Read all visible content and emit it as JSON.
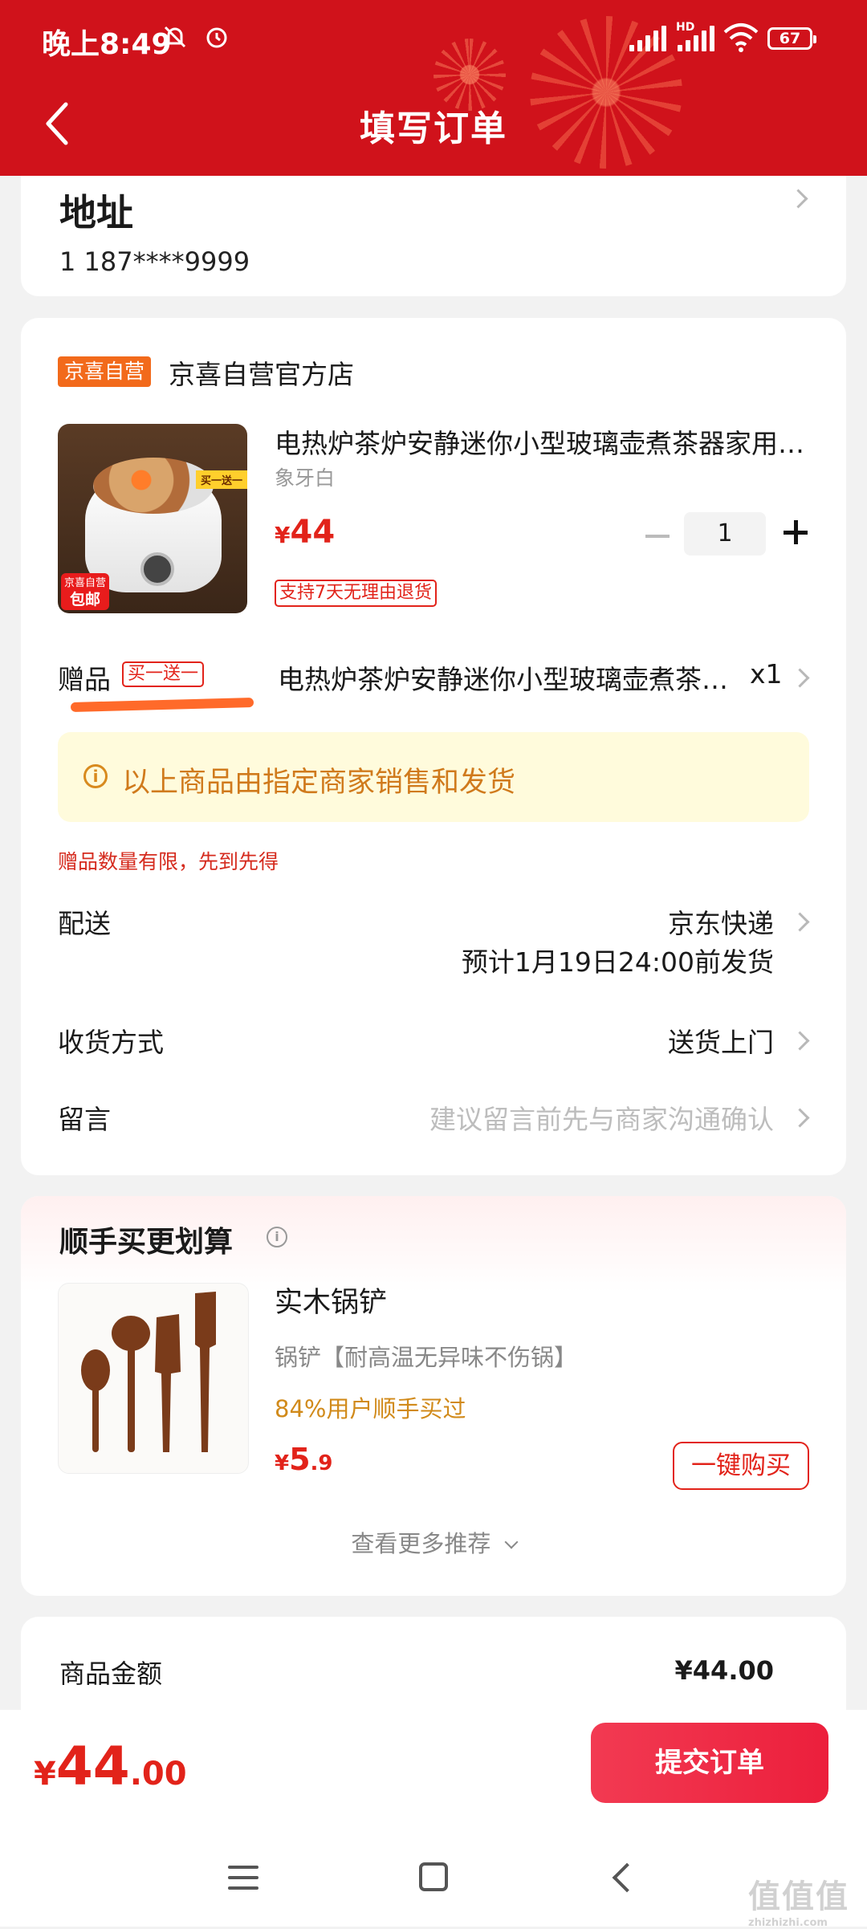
{
  "status": {
    "time": "晚上8:49",
    "battery": "67",
    "network": "HD"
  },
  "header": {
    "title": "填写订单"
  },
  "address": {
    "title": "地址",
    "phone": "1 187****9999"
  },
  "shop": {
    "badge": "京喜自营",
    "name": "京喜自营官方店",
    "product": {
      "name": "电热炉茶炉安静迷你小型玻璃壶煮茶器家用全自动",
      "spec": "象牙白",
      "price_symbol": "¥",
      "price": "44",
      "quantity": "1",
      "returns": "支持7天无理由退货",
      "image_tag": "买一送一",
      "image_badge_top": "京喜自营",
      "image_badge_bottom": "包邮"
    },
    "gift": {
      "label": "赠品",
      "tag": "买一送一",
      "name": "电热炉茶炉安静迷你小型玻璃壶煮茶器家用全自动",
      "qty": "x1"
    },
    "notice": "以上商品由指定商家销售和发货",
    "limit": "赠品数量有限，先到先得",
    "delivery": {
      "label": "配送",
      "value": "京东快递",
      "eta": "预计1月19日24:00前发货"
    },
    "receive": {
      "label": "收货方式",
      "value": "送货上门"
    },
    "message": {
      "label": "留言",
      "placeholder": "建议留言前先与商家沟通确认"
    }
  },
  "recommend": {
    "title": "顺手买更划算",
    "item": {
      "name": "实木锅铲",
      "desc": "锅铲【耐高温无异味不伤锅】",
      "sold": "84%用户顺手买过",
      "price_symbol": "¥",
      "price_int": "5",
      "price_dec": ".9",
      "buy_label": "一键购买"
    },
    "more": "查看更多推荐"
  },
  "amount": {
    "label": "商品金额",
    "value": "¥44.00"
  },
  "footer": {
    "total_symbol": "¥",
    "total_int": "44",
    "total_dec": ".00",
    "submit": "提交订单"
  },
  "watermark": {
    "text": "值值值",
    "url": "zhizhizhi.com"
  },
  "colors": {
    "brand_red": "#d0121b",
    "price_red": "#e2231a",
    "submit_red": "#ec1f3c",
    "notice_bg": "#fffbdc",
    "notice_text": "#d07a1c"
  }
}
